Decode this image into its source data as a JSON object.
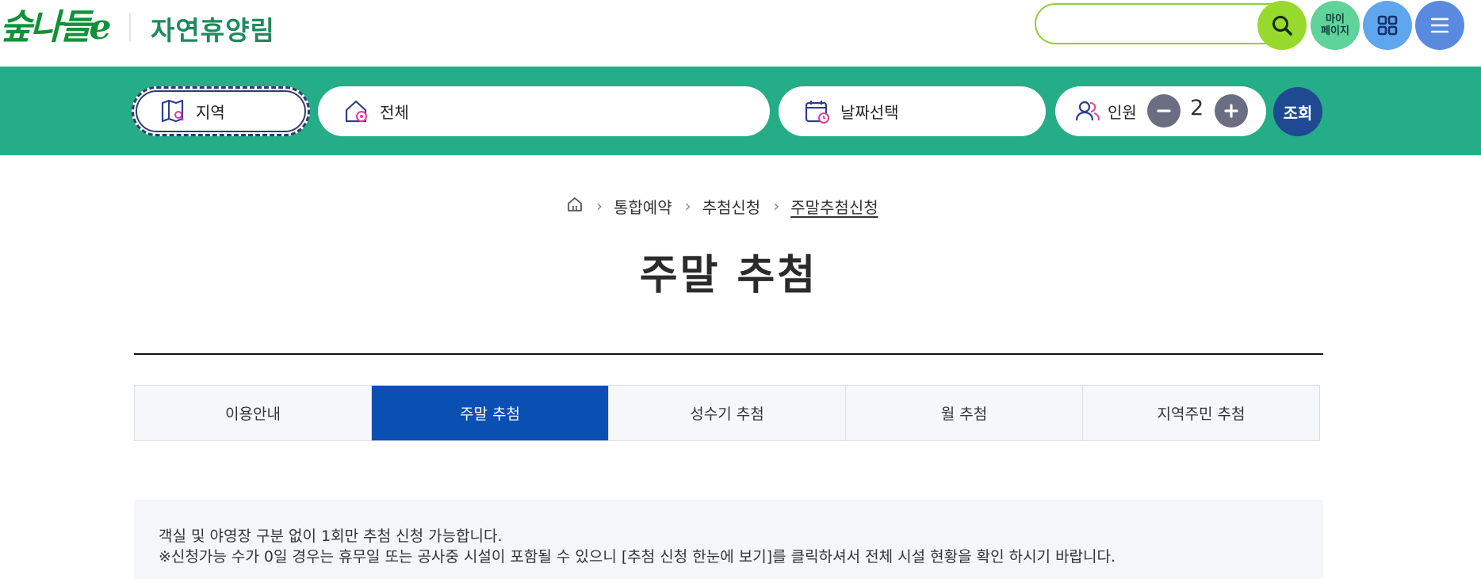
{
  "header": {
    "logo_text": "숲나들e",
    "site_name": "자연휴양림",
    "search": {
      "value": "",
      "placeholder": ""
    },
    "mypage_label_1": "마이",
    "mypage_label_2": "페이지"
  },
  "filter": {
    "region_label": "지역",
    "area_label": "전체",
    "date_label": "날짜선택",
    "people_label": "인원",
    "people_count": "2",
    "submit_label": "조회"
  },
  "breadcrumb": {
    "items": [
      "통합예약",
      "추첨신청",
      "주말추첨신청"
    ]
  },
  "page_title": "주말 추첨",
  "tabs": [
    {
      "label": "이용안내"
    },
    {
      "label": "주말 추첨"
    },
    {
      "label": "성수기 추첨"
    },
    {
      "label": "월 추첨"
    },
    {
      "label": "지역주민 추첨"
    }
  ],
  "notice": {
    "line1": "객실 및 야영장 구분 없이 1회만 추첨 신청 가능합니다.",
    "line2": "※신청가능 수가 0일 경우는 휴무일 또는 공사중 시설이 포함될 수 있으니 [추첨 신청 한눈에 보기]를 클릭하셔서 전체 시설 현황을 확인 하시기 바랍니다."
  },
  "colors": {
    "brand_green": "#24ad86",
    "tab_active": "#0a4fb2",
    "submit_blue": "#1f4a91",
    "search_lime": "#97d92c"
  }
}
